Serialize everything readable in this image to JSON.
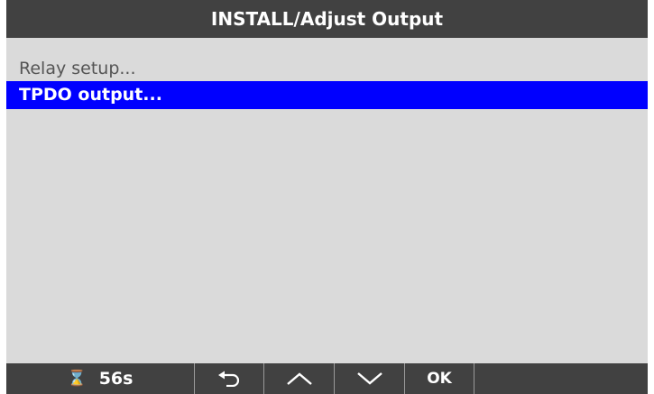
{
  "header": {
    "title": "INSTALL/Adjust Output"
  },
  "menu": {
    "items": [
      {
        "label": "Relay setup...",
        "selected": false
      },
      {
        "label": "TPDO output...",
        "selected": true
      }
    ]
  },
  "softkeys": {
    "timer_icon": "hourglass-icon",
    "timer_value": "56s",
    "back_icon": "back-arrow-icon",
    "up_icon": "chevron-up-icon",
    "down_icon": "chevron-down-icon",
    "ok_label": "OK"
  },
  "colors": {
    "title_bar": "#414141",
    "screen_bg": "#dadada",
    "selection": "#0000ff",
    "text_muted": "#555555"
  }
}
